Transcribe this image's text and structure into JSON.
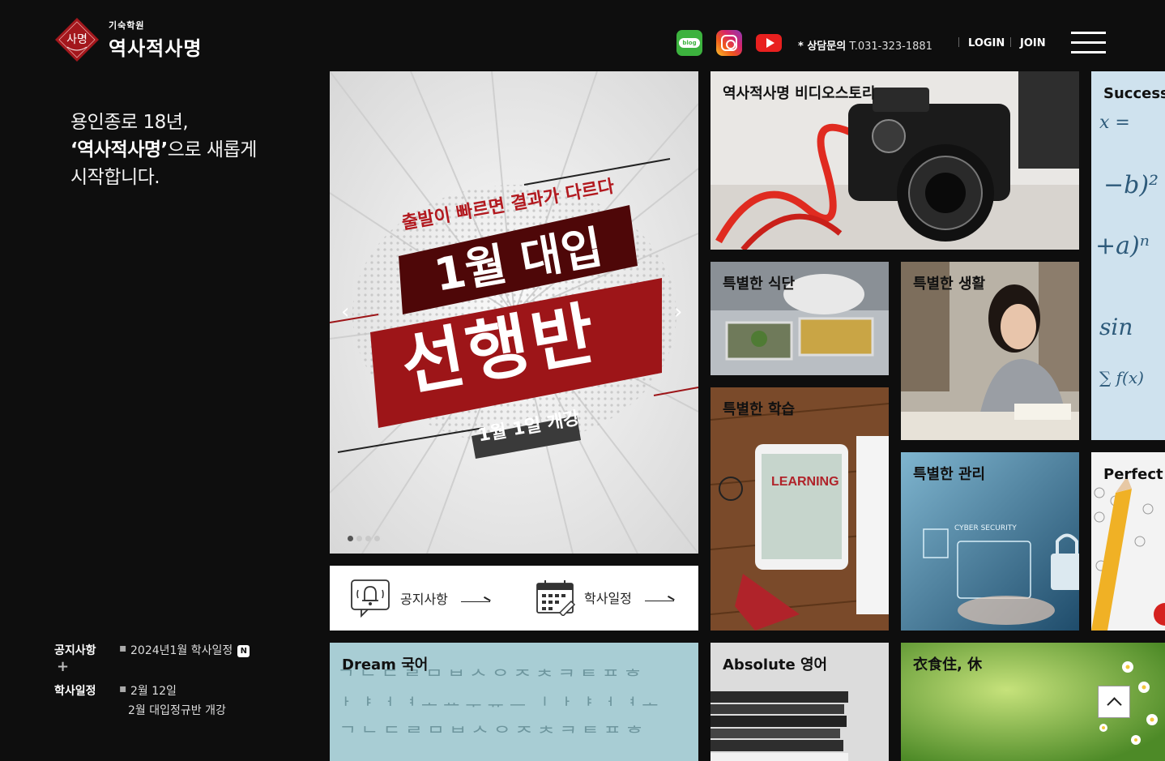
{
  "header": {
    "logo_mark": "사명",
    "logo_sub": "기숙학원",
    "logo_name": "역사적사명",
    "social": [
      {
        "name": "blog-icon",
        "label": "blog"
      },
      {
        "name": "instagram-icon"
      },
      {
        "name": "youtube-icon"
      }
    ],
    "contact_prefix": "* 상담문의",
    "contact_phone": "T.031-323-1881",
    "login": "LOGIN",
    "join": "JOIN"
  },
  "intro": {
    "line1": "용인종로 18년,",
    "line2_bold": "‘역사적사명’",
    "line2_rest": "으로 새롭게",
    "line3": "시작합니다."
  },
  "notice": {
    "notice_head": "공지사항",
    "notice_item": "2024년1월 학사일정",
    "new_badge": "N",
    "plus": "+",
    "schedule_head": "학사일정",
    "schedule_date": "2월 12일",
    "schedule_item": "2월 대입정규반 개강"
  },
  "banner": {
    "line_top": "출발이 빠르면 결과가 다르다",
    "line_mid": "1월 대입",
    "line_big": "선행반",
    "line_date": "1월 1일 개강",
    "prev": "‹",
    "next": "›"
  },
  "quickbar": {
    "notice": "공지사항",
    "schedule": "학사일정"
  },
  "tiles": {
    "video": "역사적사명 비디오스토리",
    "success": "Success 수학",
    "meal": "특별한 식단",
    "life": "특별한 생활",
    "study": "특별한 학습",
    "manage": "특별한 관리",
    "perfect": "Perfect 탐구",
    "korean": "Dream 국어",
    "english": "Absolute 영어",
    "living": "衣食住, 休",
    "learning_word": "LEARNING",
    "cyber": "CYBER SECURITY"
  }
}
